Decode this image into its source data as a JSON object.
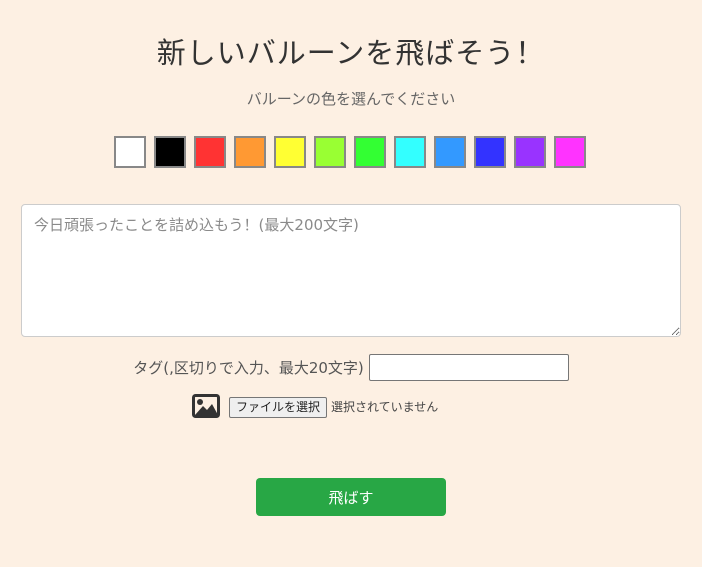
{
  "header": {
    "title": "新しいバルーンを飛ばそう！",
    "subtitle": "バルーンの色を選んでください"
  },
  "colors": [
    {
      "name": "white",
      "hex": "#ffffff"
    },
    {
      "name": "black",
      "hex": "#000000"
    },
    {
      "name": "red",
      "hex": "#ff3333"
    },
    {
      "name": "orange",
      "hex": "#ff9933"
    },
    {
      "name": "yellow",
      "hex": "#ffff33"
    },
    {
      "name": "lime",
      "hex": "#99ff33"
    },
    {
      "name": "green",
      "hex": "#33ff33"
    },
    {
      "name": "cyan",
      "hex": "#33ffff"
    },
    {
      "name": "sky-blue",
      "hex": "#3399ff"
    },
    {
      "name": "blue",
      "hex": "#3333ff"
    },
    {
      "name": "purple",
      "hex": "#9933ff"
    },
    {
      "name": "magenta",
      "hex": "#ff33ff"
    }
  ],
  "message": {
    "placeholder": "今日頑張ったことを詰め込もう！(最大200文字)",
    "value": ""
  },
  "tags": {
    "label": "タグ(,区切りで入力、最大20文字)",
    "value": ""
  },
  "file": {
    "icon": "image-icon",
    "button_label": "ファイルを選択",
    "status": "選択されていません"
  },
  "submit": {
    "label": "飛ばす",
    "color": "#28a745"
  }
}
